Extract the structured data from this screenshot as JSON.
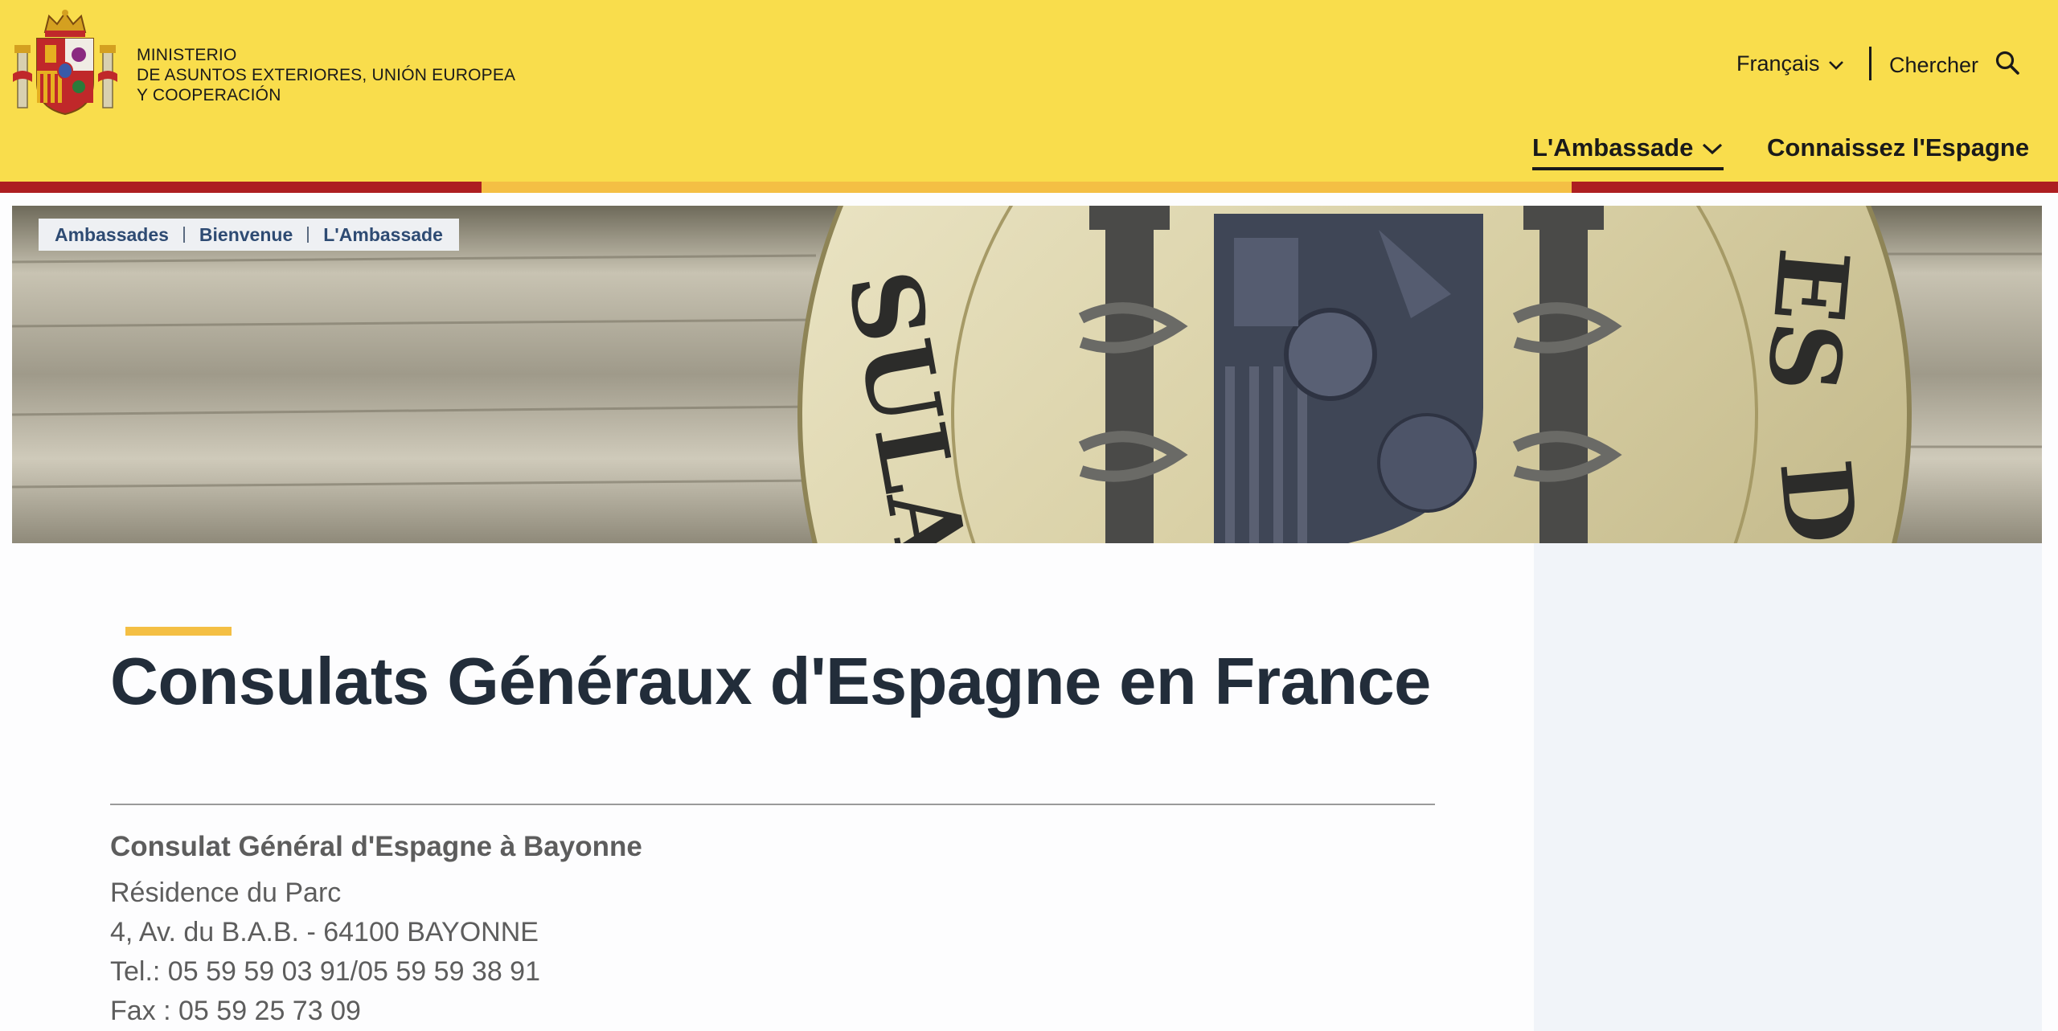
{
  "header": {
    "ministry_lines": [
      "MINISTERIO",
      "DE ASUNTOS EXTERIORES, UNIÓN EUROPEA",
      "Y COOPERACIÓN"
    ],
    "language": "Français",
    "search_label": "Chercher",
    "nav": {
      "ambassade": "L'Ambassade",
      "espagne": "Connaissez l'Espagne"
    }
  },
  "breadcrumb": [
    "Ambassades",
    "Bienvenue",
    "L'Ambassade"
  ],
  "main": {
    "title": "Consulats Généraux d'Espagne en France",
    "consulate": {
      "name": "Consulat Général d'Espagne à Bayonne",
      "lines": [
        "Résidence du Parc",
        "4, Av. du B.A.B. - 64100 BAYONNE",
        "Tel.: 05 59 59 03 91/05 59 59 38 91",
        "Fax : 05 59 25 73 09"
      ]
    }
  },
  "colors": {
    "header_bg": "#f9dd4c",
    "stripe_red": "#ad1e21",
    "stripe_yellow": "#f4bf44",
    "title": "#222d3a",
    "sidebar_bg": "#f1f4f9"
  },
  "icons": [
    "coat-of-arms-logo",
    "chevron-down-icon",
    "search-icon"
  ]
}
